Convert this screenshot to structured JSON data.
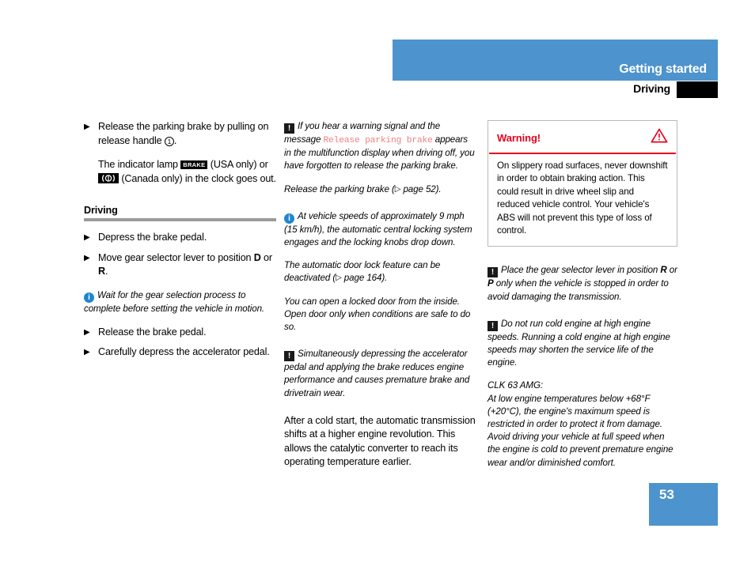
{
  "header": {
    "title": "Getting started",
    "section": "Driving",
    "accent_color": "#4d93cd",
    "tab_color": "#000000"
  },
  "left_column": {
    "bullets_top": [
      {
        "marker": "▶",
        "text_before": "Release the parking brake by pulling on release handle ",
        "circled_number": "1",
        "text_after": "."
      }
    ],
    "indicator_paragraph": {
      "part1": "The indicator lamp ",
      "lamp_usa_label": "BRAKE",
      "part2": " (USA only) or ",
      "lamp_canada_label": "canada-brake-symbol",
      "part3": " (Canada only) in the clock goes out."
    },
    "section_heading": "Driving",
    "section_rule_color": "#9a9a9a",
    "steps": [
      {
        "marker": "▶",
        "text": "Depress the brake pedal."
      },
      {
        "marker": "▶",
        "text_before": "Move gear selector lever to position ",
        "bold1": "D",
        "mid": " or ",
        "bold2": "R",
        "text_after": "."
      }
    ],
    "info_note": "Wait for the gear selection process to complete before setting the vehicle in motion.",
    "steps_after": [
      {
        "marker": "▶",
        "text": "Release the brake pedal."
      },
      {
        "marker": "▶",
        "text": "Carefully depress the accelerator pedal."
      }
    ]
  },
  "middle_column": {
    "warning_note_1": {
      "icon": "warning-exclamation-icon",
      "part1": "If you hear a warning signal and the message ",
      "display_message": "Release parking brake",
      "part2": " appears in the multifunction display when driving off, you have forgotten to release the parking brake."
    },
    "cross_ref_1": {
      "text_before": "Release the parking brake (",
      "ref_marker": "▷",
      "ref_text": " page 52)."
    },
    "info_note_1": {
      "icon": "info-icon",
      "text": "At vehicle speeds of approximately 9 mph (15 km/h), the automatic central locking system engages and the locking knobs drop down."
    },
    "cross_ref_2": {
      "text_before": "The automatic door lock feature can be deactivated (",
      "ref_marker": "▷",
      "ref_text": " page 164)."
    },
    "note_door": "You can open a locked door from the inside. Open door only when conditions are safe to do so.",
    "warning_note_2": {
      "icon": "warning-exclamation-icon",
      "text": "Simultaneously depressing the accelerator pedal and applying the brake reduces engine performance and causes premature brake and drivetrain wear."
    },
    "cold_start_text": "After a cold start, the automatic transmission shifts at a higher engine revolution. This allows the catalytic converter to reach its operating temperature earlier."
  },
  "right_column": {
    "warning_box": {
      "title": "Warning!",
      "icon": "warning-triangle-icon",
      "title_color": "#e8001c",
      "body": "On slippery road surfaces, never downshift in order to obtain braking action. This could result in drive wheel slip and reduced vehicle control. Your vehicle's ABS will not prevent this type of loss of control."
    },
    "warning_note_1": {
      "icon": "warning-exclamation-icon",
      "part1": "Place the gear selector lever in position ",
      "bold1": "R",
      "part2": " or ",
      "bold2": "P",
      "part3": " only when the vehicle is stopped in order to avoid damaging the transmission."
    },
    "warning_note_2": {
      "icon": "warning-exclamation-icon",
      "text": "Do not run cold engine at high engine speeds. Running a cold engine at high engine speeds may shorten the service life of the engine."
    },
    "amg_note": {
      "heading": "CLK 63 AMG:",
      "text": "At low engine temperatures below +68°F (+20°C), the engine's maximum speed is restricted in order to protect it from damage. Avoid driving your vehicle at full speed when the engine is cold to prevent premature engine wear and/or diminished comfort."
    }
  },
  "footer": {
    "page_number": "53"
  }
}
